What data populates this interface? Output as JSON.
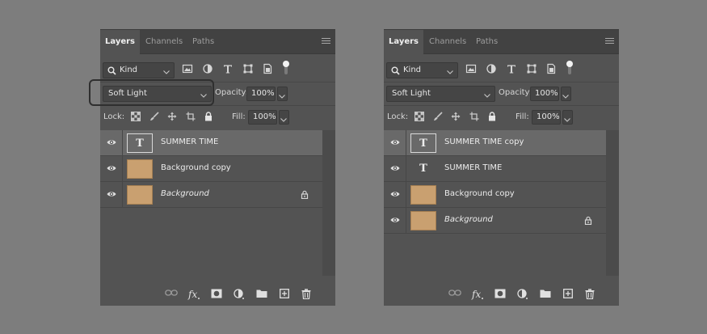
{
  "panels": [
    {
      "tabs": [
        "Layers",
        "Channels",
        "Paths"
      ],
      "kind_label": "Kind",
      "blend_mode": "Soft Light",
      "opacity_label": "Opacity:",
      "opacity_value": "100%",
      "lock_label": "Lock:",
      "fill_label": "Fill:",
      "fill_value": "100%",
      "layers": [
        {
          "name": "SUMMER TIME",
          "type": "text",
          "selected": true,
          "italic": false,
          "locked": false
        },
        {
          "name": "Background copy",
          "type": "image",
          "selected": false,
          "italic": false,
          "locked": false
        },
        {
          "name": "Background",
          "type": "image",
          "selected": false,
          "italic": true,
          "locked": true
        }
      ]
    },
    {
      "tabs": [
        "Layers",
        "Channels",
        "Paths"
      ],
      "kind_label": "Kind",
      "blend_mode": "Soft Light",
      "opacity_label": "Opacity:",
      "opacity_value": "100%",
      "lock_label": "Lock:",
      "fill_label": "Fill:",
      "fill_value": "100%",
      "layers": [
        {
          "name": "SUMMER TIME copy",
          "type": "text",
          "selected": true,
          "italic": false,
          "locked": false
        },
        {
          "name": "SUMMER TIME",
          "type": "text-plain",
          "selected": false,
          "italic": false,
          "locked": false
        },
        {
          "name": "Background copy",
          "type": "image",
          "selected": false,
          "italic": false,
          "locked": false
        },
        {
          "name": "Background",
          "type": "image",
          "selected": false,
          "italic": true,
          "locked": true
        }
      ]
    }
  ],
  "colors": {
    "background": "#7d7d7d",
    "panel": "#535353",
    "tabbar": "#424242",
    "selected_row": "#696969",
    "paper_thumb": "#c9a070"
  },
  "icons": {
    "search": "search-icon",
    "filter_pixel": "image-filter-icon",
    "filter_adjust": "adjustment-filter-icon",
    "filter_text": "text-filter-icon",
    "filter_shape": "shape-filter-icon",
    "filter_smart": "smart-object-filter-icon",
    "eye": "eye-icon",
    "lock": "lock-icon"
  }
}
